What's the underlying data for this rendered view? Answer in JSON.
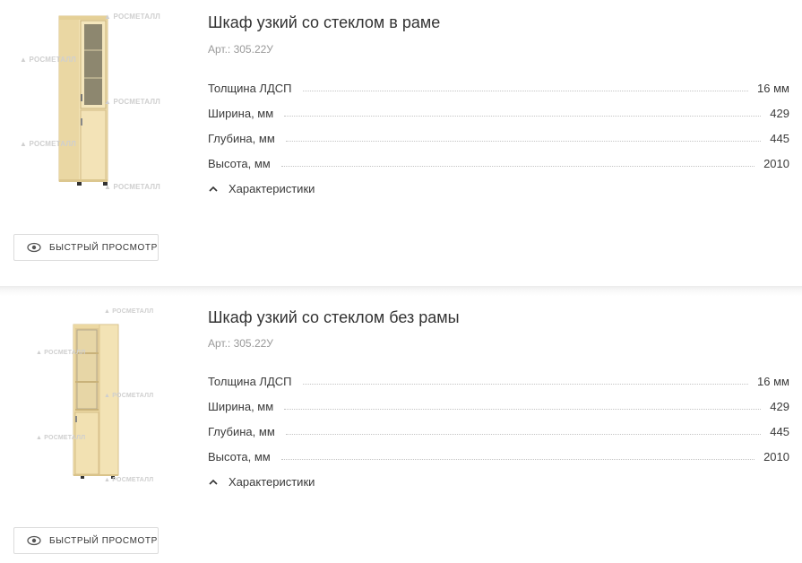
{
  "products": [
    {
      "title": "Шкаф узкий со стеклом в раме",
      "article": "Арт.: 305.22У",
      "specs": [
        {
          "label": "Толщина ЛДСП",
          "value": "16 мм"
        },
        {
          "label": "Ширина, мм",
          "value": "429"
        },
        {
          "label": "Глубина, мм",
          "value": "445"
        },
        {
          "label": "Высота, мм",
          "value": "2010"
        }
      ],
      "characteristics_toggle": "Характеристики",
      "quick_view": "БЫСТРЫЙ ПРОСМОТР",
      "watermark": "РОСМЕТАЛЛ"
    },
    {
      "title": "Шкаф узкий со стеклом без рамы",
      "article": "Арт.: 305.22У",
      "specs": [
        {
          "label": "Толщина ЛДСП",
          "value": "16 мм"
        },
        {
          "label": "Ширина, мм",
          "value": "429"
        },
        {
          "label": "Глубина, мм",
          "value": "445"
        },
        {
          "label": "Высота, мм",
          "value": "2010"
        }
      ],
      "characteristics_toggle": "Характеристики",
      "quick_view": "БЫСТРЫЙ ПРОСМОТР",
      "watermark": "РОСМЕТАЛЛ"
    }
  ],
  "colors": {
    "wood": "#f0dfae",
    "wood_dark": "#d9c38a",
    "glass": "#8c8670",
    "text": "#3a3a3a",
    "muted": "#9a9a9a"
  },
  "icons": {
    "quick_view": "eye-icon",
    "toggle": "chevron-up-icon",
    "watermark": "logo-triangle"
  }
}
